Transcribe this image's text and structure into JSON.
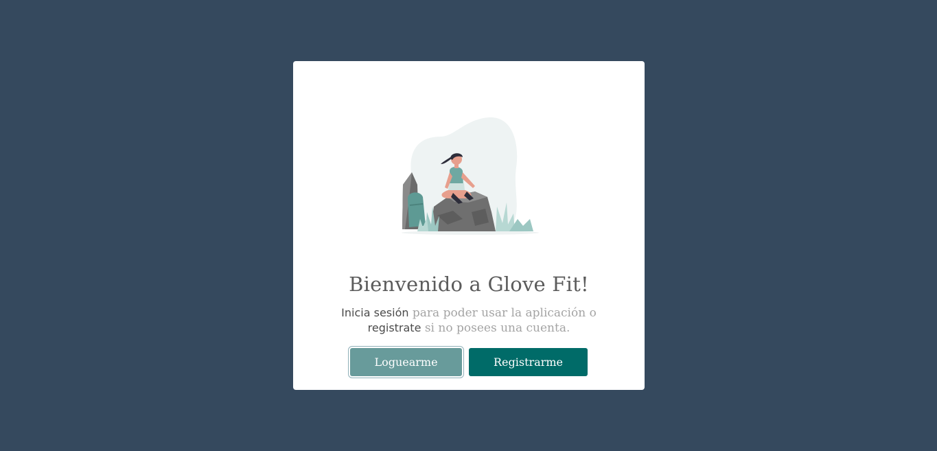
{
  "modal": {
    "title": "Bienvenido a Glove Fit!",
    "subtitle": {
      "login_strong": "Inicia sesión",
      "text_1": " para poder usar la aplicación o",
      "register_strong": "registrate",
      "text_2": " si no posees una cuenta."
    },
    "illustration": {
      "icon": "woman-meditating-on-rock-illustration"
    },
    "buttons": {
      "login_label": "Loguearme",
      "register_label": "Registrarme"
    }
  },
  "colors": {
    "background": "#35495e",
    "card": "#ffffff",
    "login_button": "#689b9b",
    "register_button": "#006b68",
    "title_text": "#5b5b5b"
  }
}
